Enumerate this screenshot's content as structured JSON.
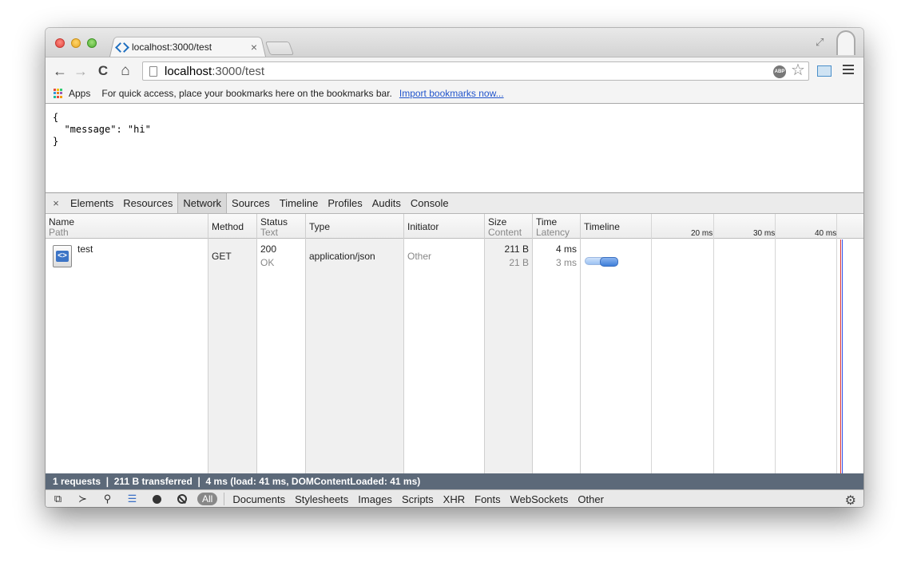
{
  "tab": {
    "title": "localhost:3000/test",
    "close": "×"
  },
  "toolbar": {
    "back": "←",
    "forward": "→",
    "reload": "C",
    "home": "⌂",
    "url_host": "localhost",
    "url_path": ":3000/test",
    "abp": "ABP",
    "star": "☆"
  },
  "bookmarks": {
    "apps": "Apps",
    "hint": "For quick access, place your bookmarks here on the bookmarks bar.",
    "import": "Import bookmarks now..."
  },
  "page": {
    "json": "{\n  \"message\": \"hi\"\n}"
  },
  "devtools": {
    "close": "×",
    "tabs": [
      "Elements",
      "Resources",
      "Network",
      "Sources",
      "Timeline",
      "Profiles",
      "Audits",
      "Console"
    ],
    "active_tab": "Network",
    "columns": {
      "name": "Name",
      "path": "Path",
      "method": "Method",
      "status": "Status",
      "text": "Text",
      "type": "Type",
      "initiator": "Initiator",
      "size": "Size",
      "content": "Content",
      "time": "Time",
      "latency": "Latency",
      "timeline": "Timeline"
    },
    "ticks": [
      "20 ms",
      "30 ms",
      "40 ms"
    ],
    "rows": [
      {
        "name": "test",
        "method": "GET",
        "status": "200",
        "status_text": "OK",
        "type": "application/json",
        "initiator": "Other",
        "size": "211 B",
        "content": "21 B",
        "time": "4 ms",
        "latency": "3 ms"
      }
    ],
    "summary": "1 requests  ❘  211 B transferred  ❘  4 ms (load: 41 ms, DOMContentLoaded: 41 ms)",
    "filters": [
      "All",
      "Documents",
      "Stylesheets",
      "Images",
      "Scripts",
      "XHR",
      "Fonts",
      "WebSockets",
      "Other"
    ],
    "load_line_color": "#dd3333",
    "dcl_line_color": "#3355ee"
  }
}
